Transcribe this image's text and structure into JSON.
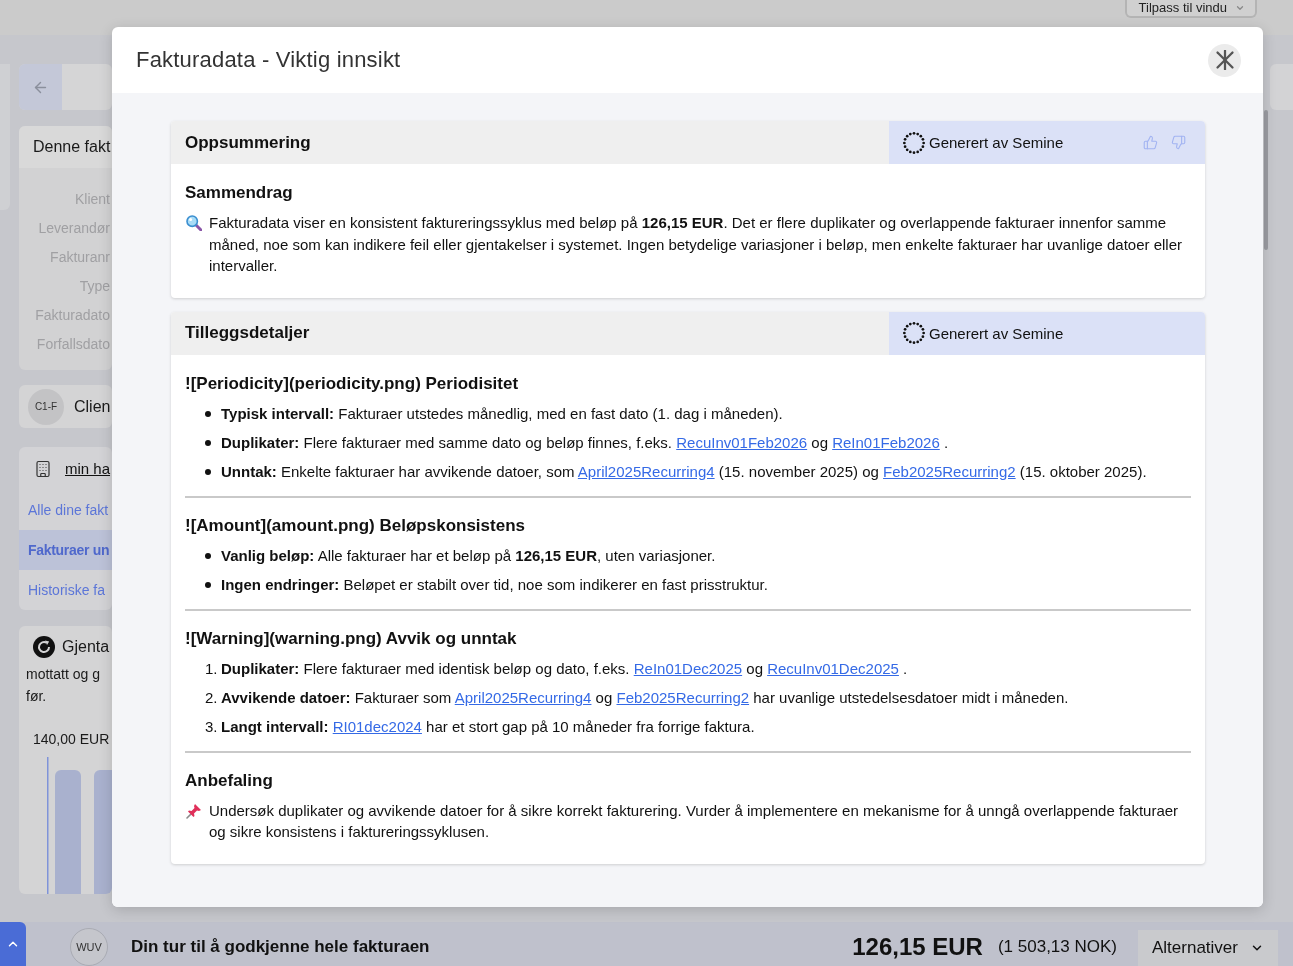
{
  "background": {
    "fit_button": "Tilpass til vindu",
    "invoice_card": {
      "title": "Denne fakt",
      "fields": [
        "Klient",
        "Leverandør",
        "Fakturanr",
        "Type",
        "Fakturadato",
        "Forfallsdato"
      ]
    },
    "client": {
      "initials": "C1-F",
      "name": "Clien"
    },
    "company": {
      "link": "min ha"
    },
    "nav": [
      {
        "label": "Alle dine fakt",
        "selected": false
      },
      {
        "label": "Fakturaer un",
        "selected": true
      },
      {
        "label": "Historiske fa",
        "selected": false
      }
    ],
    "recurring_card": {
      "title": "Gjenta",
      "lines": [
        "mottatt og g",
        "før."
      ],
      "amount": "140,00 EUR"
    }
  },
  "modal": {
    "title": "Fakturadata - Viktig innsikt",
    "sections": [
      {
        "title": "Oppsummering",
        "badge": "Generert av Semine",
        "show_rating": true,
        "blocks": [
          {
            "kind": "heading",
            "text": "Sammendrag"
          },
          {
            "kind": "summary",
            "text": "Fakturadata viser en konsistent faktureringssyklus med beløp på **126,15 EUR**. Det er flere duplikater og overlappende fakturaer innenfor samme måned, noe som kan indikere feil eller gjentakelser i systemet. Ingen betydelige variasjoner i beløp, men enkelte fakturaer har uvanlige datoer eller intervaller."
          }
        ]
      },
      {
        "title": "Tilleggsdetaljer",
        "badge": "Generert av Semine",
        "show_rating": false,
        "blocks": [
          {
            "kind": "heading",
            "text": "![Periodicity](periodicity.png) Periodisitet"
          },
          {
            "kind": "bullets",
            "items": [
              {
                "segments": [
                  {
                    "kind": "text",
                    "text": "**Typisk intervall:** Fakturaer utstedes månedlig, med en fast dato (1. dag i måneden)."
                  }
                ]
              },
              {
                "segments": [
                  {
                    "kind": "text",
                    "text": "**Duplikater:** Flere fakturaer med samme dato og beløp finnes, f.eks. "
                  },
                  {
                    "kind": "link",
                    "text": "RecuInv01Feb2026"
                  },
                  {
                    "kind": "text",
                    "text": " og "
                  },
                  {
                    "kind": "link",
                    "text": "ReIn01Feb2026"
                  },
                  {
                    "kind": "text",
                    "text": " ."
                  }
                ]
              },
              {
                "segments": [
                  {
                    "kind": "text",
                    "text": "**Unntak:** Enkelte fakturaer har avvikende datoer, som "
                  },
                  {
                    "kind": "link",
                    "text": "April2025Recurring4"
                  },
                  {
                    "kind": "text",
                    "text": " (15. november 2025) og "
                  },
                  {
                    "kind": "link",
                    "text": "Feb2025Recurring2"
                  },
                  {
                    "kind": "text",
                    "text": " (15. oktober 2025)."
                  }
                ]
              }
            ]
          },
          {
            "kind": "rule"
          },
          {
            "kind": "heading",
            "text": "![Amount](amount.png) Beløpskonsistens"
          },
          {
            "kind": "bullets",
            "items": [
              {
                "segments": [
                  {
                    "kind": "text",
                    "text": "**Vanlig beløp:** Alle fakturaer har et beløp på **126,15 EUR**, uten variasjoner."
                  }
                ]
              },
              {
                "segments": [
                  {
                    "kind": "text",
                    "text": "**Ingen endringer:** Beløpet er stabilt over tid, noe som indikerer en fast prisstruktur."
                  }
                ]
              }
            ]
          },
          {
            "kind": "rule"
          },
          {
            "kind": "heading",
            "text": "![Warning](warning.png) Avvik og unntak"
          },
          {
            "kind": "numbered",
            "items": [
              {
                "number": "1.",
                "segments": [
                  {
                    "kind": "text",
                    "text": "**Duplikater:** Flere fakturaer med identisk beløp og dato, f.eks. "
                  },
                  {
                    "kind": "link",
                    "text": "ReIn01Dec2025"
                  },
                  {
                    "kind": "text",
                    "text": " og "
                  },
                  {
                    "kind": "link",
                    "text": "RecuInv01Dec2025"
                  },
                  {
                    "kind": "text",
                    "text": " ."
                  }
                ]
              },
              {
                "number": "2.",
                "segments": [
                  {
                    "kind": "text",
                    "text": "**Avvikende datoer:** Fakturaer som "
                  },
                  {
                    "kind": "link",
                    "text": "April2025Recurring4"
                  },
                  {
                    "kind": "text",
                    "text": " og "
                  },
                  {
                    "kind": "link",
                    "text": "Feb2025Recurring2"
                  },
                  {
                    "kind": "text",
                    "text": " har uvanlige utstedelsesdatoer midt i måneden."
                  }
                ]
              },
              {
                "number": "3.",
                "segments": [
                  {
                    "kind": "text",
                    "text": "**Langt intervall:** "
                  },
                  {
                    "kind": "link",
                    "text": "RI01dec2024"
                  },
                  {
                    "kind": "text",
                    "text": " har et stort gap på 10 måneder fra forrige faktura."
                  }
                ]
              }
            ]
          },
          {
            "kind": "rule"
          },
          {
            "kind": "heading",
            "text": "Anbefaling"
          },
          {
            "kind": "recommendation",
            "text": "Undersøk duplikater og avvikende datoer for å sikre korrekt fakturering. Vurder å implementere en mekanisme for å unngå overlappende fakturaer og sikre konsistens i faktureringssyklusen."
          }
        ]
      }
    ]
  },
  "bottom_bar": {
    "avatar": "WUV",
    "message": "Din tur til å godkjenne hele fakturaen",
    "amount": "126,15 EUR",
    "converted": "(1 503,13 NOK)",
    "options_button": "Alternativer"
  }
}
